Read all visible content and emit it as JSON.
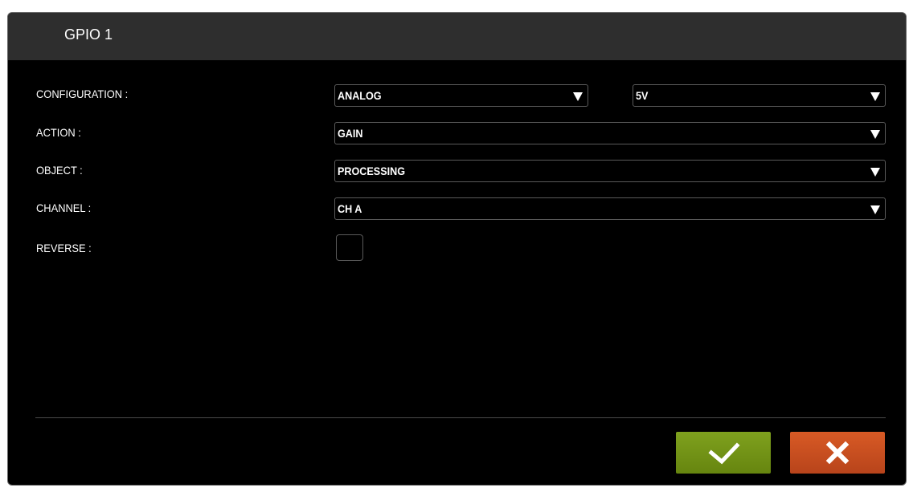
{
  "dialog": {
    "title": "GPIO 1"
  },
  "form": {
    "configuration": {
      "label": "CONFIGURATION :",
      "value": "ANALOG",
      "voltage": "5V"
    },
    "action": {
      "label": "ACTION :",
      "value": "GAIN"
    },
    "object": {
      "label": "OBJECT :",
      "value": "PROCESSING"
    },
    "channel": {
      "label": "CHANNEL :",
      "value": "CH A"
    },
    "reverse": {
      "label": "REVERSE :",
      "checked": false
    }
  },
  "buttons": {
    "confirm_icon": "checkmark-icon",
    "cancel_icon": "close-icon",
    "confirm_color": "#74951a",
    "cancel_color": "#c84e1f"
  }
}
